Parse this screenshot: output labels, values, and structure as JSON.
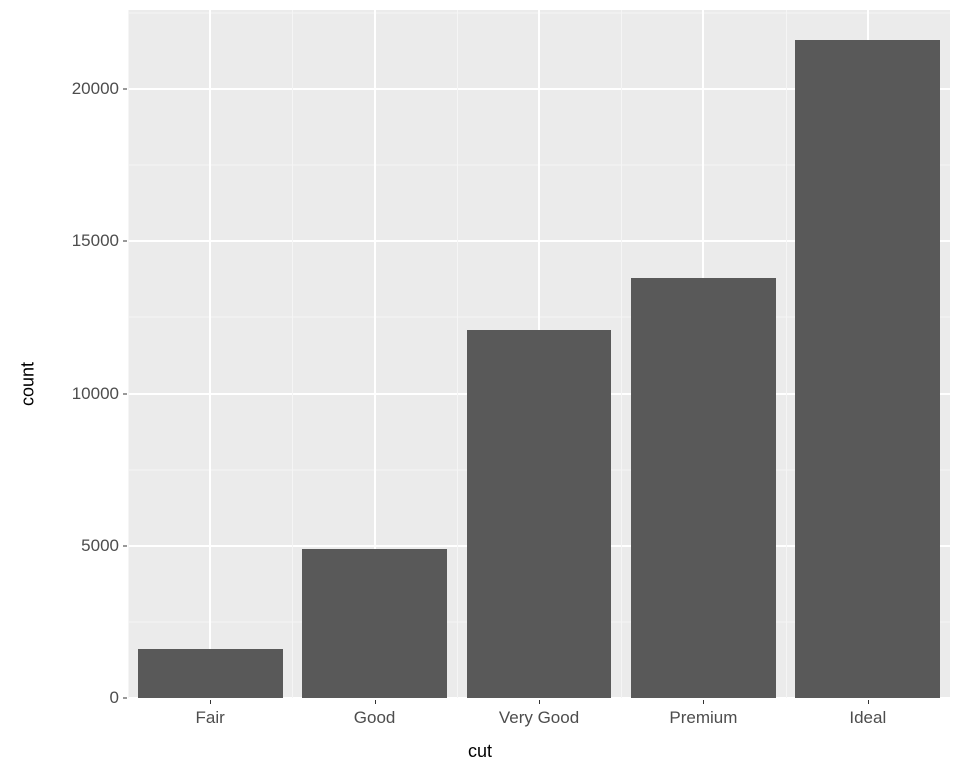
{
  "chart_data": {
    "type": "bar",
    "categories": [
      "Fair",
      "Good",
      "Very Good",
      "Premium",
      "Ideal"
    ],
    "values": [
      1600,
      4900,
      12100,
      13800,
      21600
    ],
    "xlabel": "cut",
    "ylabel": "count",
    "ylim": [
      0,
      22600
    ],
    "y_ticks": [
      0,
      5000,
      10000,
      15000,
      20000
    ],
    "y_minor": [
      2500,
      7500,
      12500,
      17500,
      22500
    ],
    "bar_color": "#595959",
    "panel_bg": "#ebebeb"
  }
}
